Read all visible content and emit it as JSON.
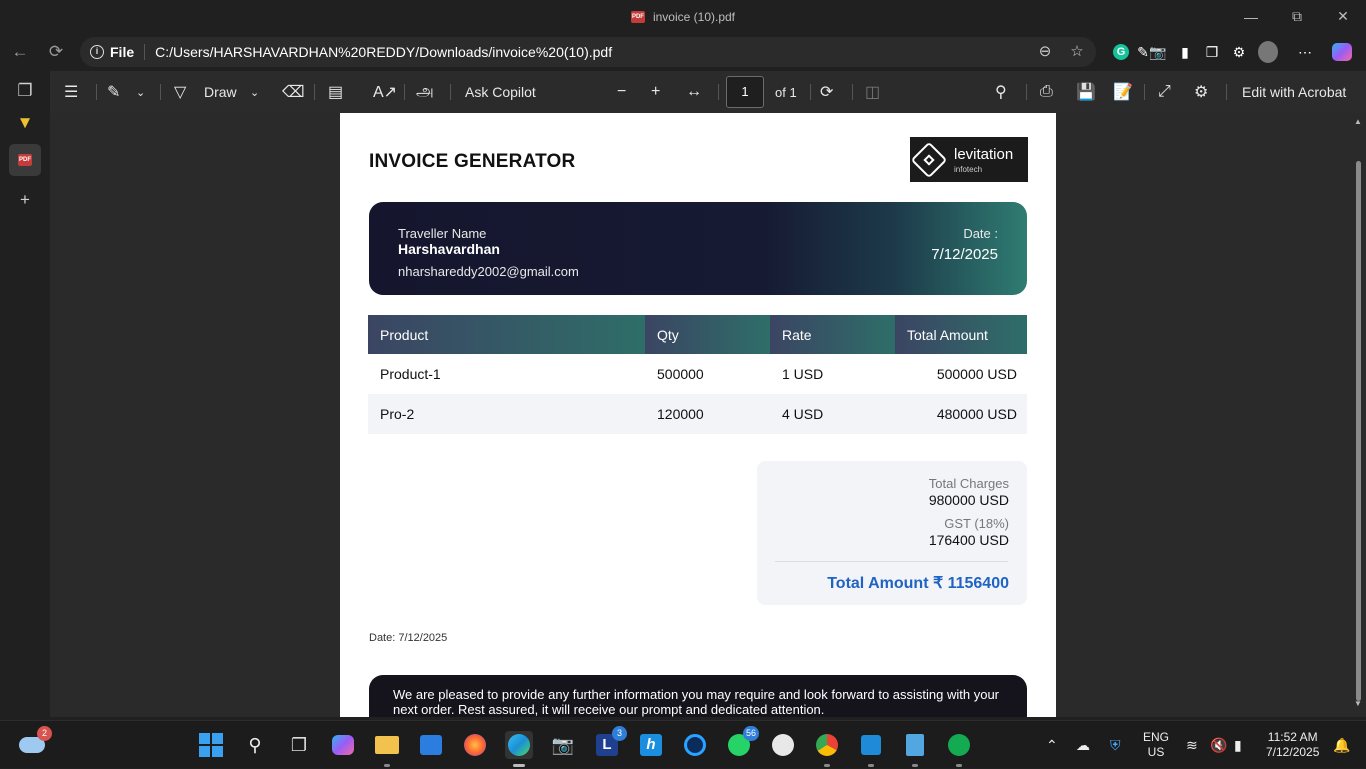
{
  "window": {
    "title": "invoice (10).pdf",
    "minimize_icon": "minimize-icon",
    "maximize_icon": "restore-icon",
    "close_icon": "close-icon"
  },
  "browser": {
    "address_label": "File",
    "url": "C:/Users/HARSHAVARDHAN%20REDDY/Downloads/invoice%20(10).pdf"
  },
  "pdf_toolbar": {
    "draw_label": "Draw",
    "copilot_label": "Ask Copilot",
    "page_current": "1",
    "page_total": "of 1",
    "acrobat_label": "Edit with Acrobat"
  },
  "invoice": {
    "title": "INVOICE GENERATOR",
    "logo_name": "levitation",
    "logo_sub": "infotech",
    "traveller_label": "Traveller Name",
    "traveller_name": "Harshavardhan",
    "traveller_email": "nharshareddy2002@gmail.com",
    "date_label": "Date :",
    "date_value": "7/12/2025",
    "columns": [
      "Product",
      "Qty",
      "Rate",
      "Total Amount"
    ],
    "rows": [
      [
        "Product-1",
        "500000",
        "1 USD",
        "500000 USD"
      ],
      [
        "Pro-2",
        "120000",
        "4 USD",
        "480000 USD"
      ]
    ],
    "total_charges_label": "Total Charges",
    "total_charges_value": "980000 USD",
    "gst_label": "GST (18%)",
    "gst_value": "176400 USD",
    "total_amount": "Total Amount ₹ 1156400",
    "footer_date": "Date: 7/12/2025",
    "note": "We are pleased to provide any further information you may require and look forward to assisting with your next order. Rest assured, it will receive our prompt and dedicated attention."
  },
  "taskbar": {
    "weather_badge": "2",
    "l_badge": "3",
    "whatsapp_badge": "56",
    "lang_line1": "ENG",
    "lang_line2": "US",
    "time": "11:52 AM",
    "date": "7/12/2025"
  },
  "colors": {
    "accent_blue": "#1f63c4",
    "card_dark": "#15162e",
    "card_teal": "#2f7c72"
  }
}
